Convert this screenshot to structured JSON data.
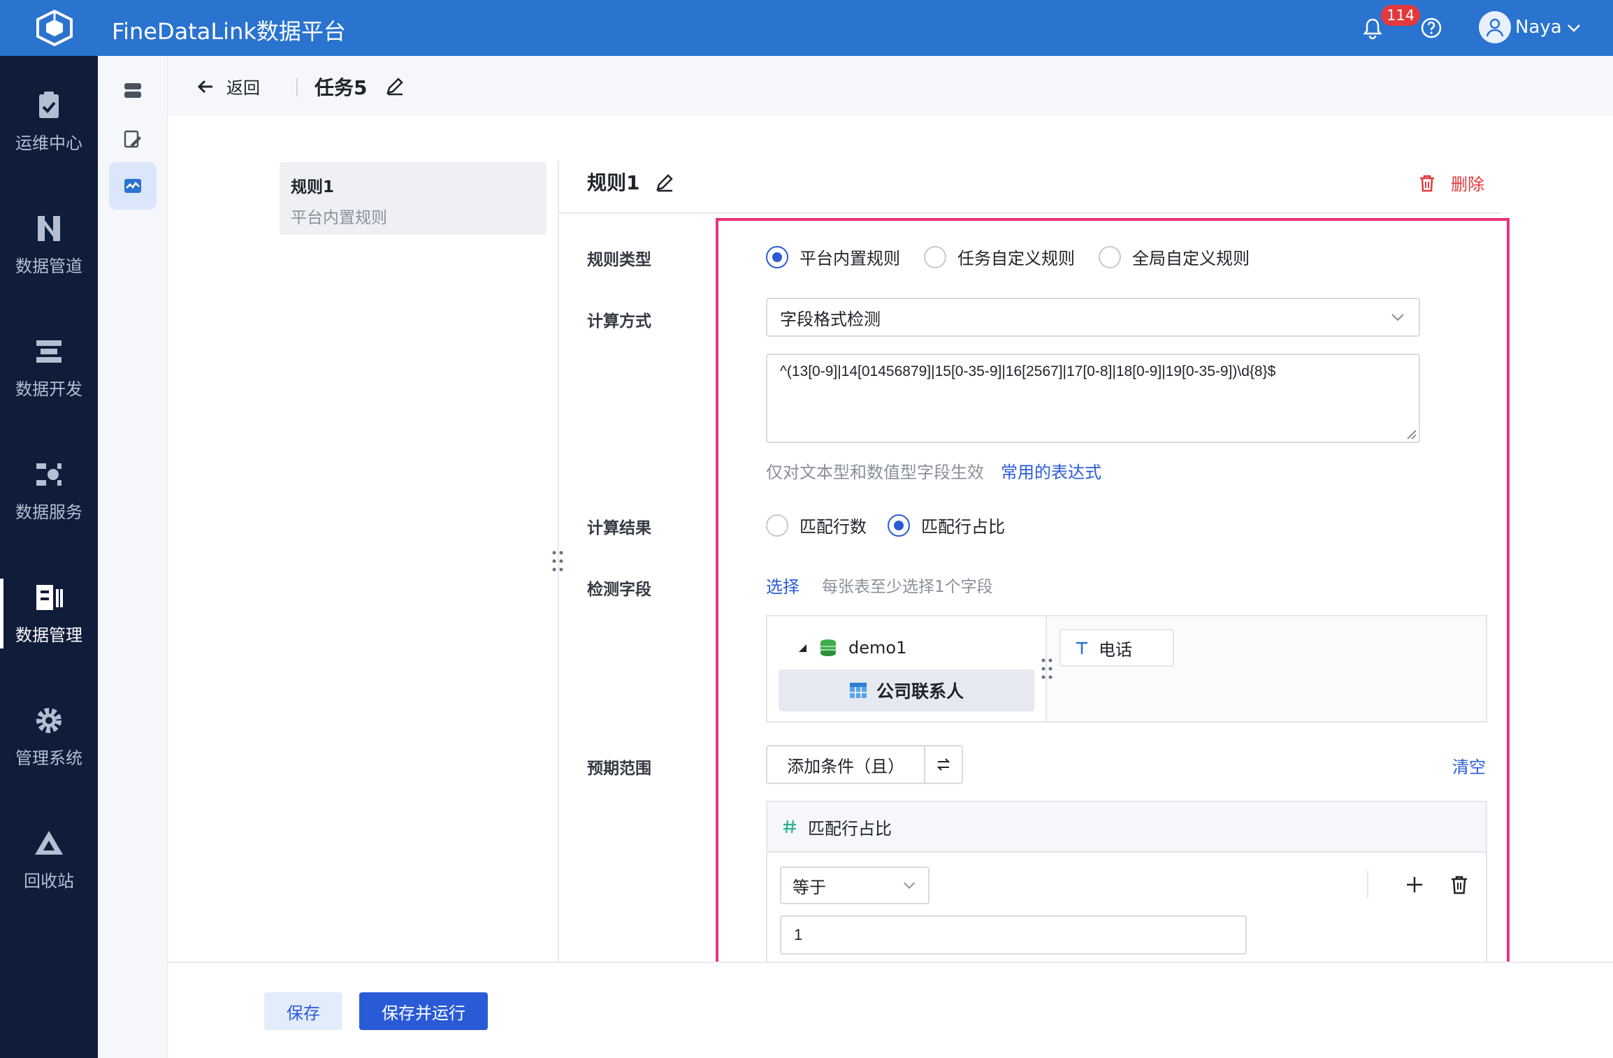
{
  "app": {
    "title": "FineDataLink数据平台",
    "notification_count": "114",
    "username": "Naya"
  },
  "colors": {
    "header": "#2a73cf",
    "nav": "#0f1c3a",
    "primary": "#2a5bd7",
    "danger": "#e4393c",
    "highlight_box": "#e8337a"
  },
  "leftnav": {
    "items": [
      {
        "label": "运维中心",
        "icon": "clipboard-check-icon"
      },
      {
        "label": "数据管道",
        "icon": "pipeline-icon"
      },
      {
        "label": "数据开发",
        "icon": "dev-icon"
      },
      {
        "label": "数据服务",
        "icon": "service-icon"
      },
      {
        "label": "数据管理",
        "icon": "data-manage-icon"
      },
      {
        "label": "管理系统",
        "icon": "gear-icon"
      },
      {
        "label": "回收站",
        "icon": "recycle-icon"
      }
    ]
  },
  "breadcrumb": {
    "back": "返回",
    "task": "任务5"
  },
  "rule_list": [
    {
      "name": "规则1",
      "subtitle": "平台内置规则"
    }
  ],
  "rule": {
    "title": "规则1",
    "delete": "删除",
    "labels": {
      "type": "规则类型",
      "method": "计算方式",
      "result": "计算结果",
      "fields": "检测字段",
      "range": "预期范围"
    },
    "type_options": [
      "平台内置规则",
      "任务自定义规则",
      "全局自定义规则"
    ],
    "method_value": "字段格式检测",
    "expression": "^(13[0-9]|14[01456879]|15[0-35-9]|16[2567]|17[0-8]|18[0-9]|19[0-35-9])\\d{8}$",
    "hint": "仅对文本型和数值型字段生效",
    "hint_link": "常用的表达式",
    "result_options": [
      "匹配行数",
      "匹配行占比"
    ],
    "select_link": "选择",
    "select_hint": "每张表至少选择1个字段",
    "tree_db": "demo1",
    "tree_table": "公司联系人",
    "field_tag": "电话",
    "add_condition": "添加条件（且）",
    "clear": "清空",
    "condition_name": "匹配行占比",
    "operator": "等于",
    "condition_value": "1"
  },
  "footer": {
    "save": "保存",
    "save_run": "保存并运行"
  }
}
